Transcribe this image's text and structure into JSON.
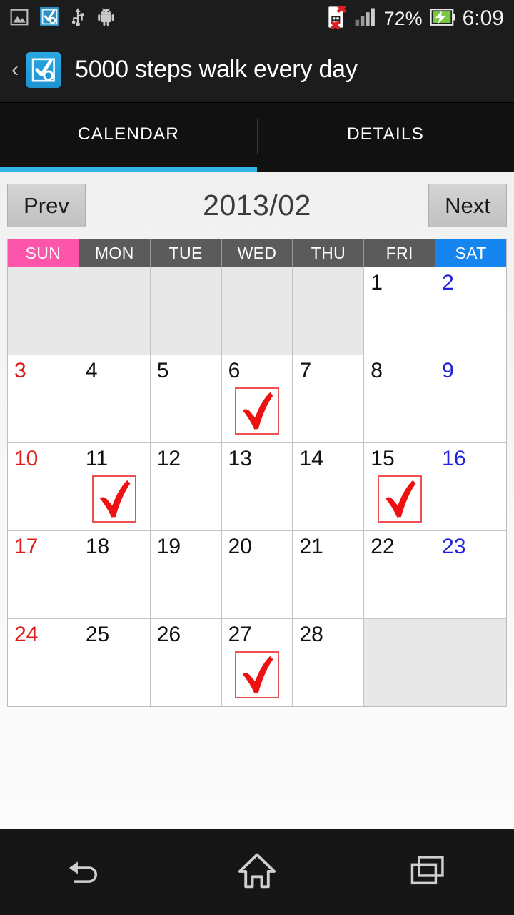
{
  "status_bar": {
    "notification_icons": [
      "image-icon",
      "app-checkmark-icon",
      "usb-icon",
      "android-icon"
    ],
    "sim_icon": "sim-card-error-icon",
    "signal_icon": "signal-bars-icon",
    "battery_percent": "72%",
    "battery_icon": "battery-charging-icon",
    "clock": "6:09"
  },
  "app_bar": {
    "back_label": "‹",
    "icon": "app-icon-checkmark",
    "title": "5000 steps walk every day"
  },
  "tabs": [
    {
      "label": "CALENDAR",
      "active": true
    },
    {
      "label": "DETAILS",
      "active": false
    }
  ],
  "month_nav": {
    "prev_label": "Prev",
    "next_label": "Next",
    "month_label": "2013/02"
  },
  "calendar": {
    "day_headers": [
      "SUN",
      "MON",
      "TUE",
      "WED",
      "THU",
      "FRI",
      "SAT"
    ],
    "colors": {
      "sunday_header": "#fc55a9",
      "saturday_header": "#1785ef",
      "weekday_header": "#5b5b5b",
      "sunday_text": "#e01b1b",
      "saturday_text": "#2222dd",
      "check_mark": "#ee1111",
      "check_border": "#ec5050",
      "tab_accent": "#33b5e5"
    },
    "weeks": [
      [
        {
          "day": "",
          "checked": false
        },
        {
          "day": "",
          "checked": false
        },
        {
          "day": "",
          "checked": false
        },
        {
          "day": "",
          "checked": false
        },
        {
          "day": "",
          "checked": false
        },
        {
          "day": "1",
          "checked": false
        },
        {
          "day": "2",
          "checked": false
        }
      ],
      [
        {
          "day": "3",
          "checked": false
        },
        {
          "day": "4",
          "checked": false
        },
        {
          "day": "5",
          "checked": false
        },
        {
          "day": "6",
          "checked": true
        },
        {
          "day": "7",
          "checked": false
        },
        {
          "day": "8",
          "checked": false
        },
        {
          "day": "9",
          "checked": false
        }
      ],
      [
        {
          "day": "10",
          "checked": false
        },
        {
          "day": "11",
          "checked": true
        },
        {
          "day": "12",
          "checked": false
        },
        {
          "day": "13",
          "checked": false
        },
        {
          "day": "14",
          "checked": false
        },
        {
          "day": "15",
          "checked": true
        },
        {
          "day": "16",
          "checked": false
        }
      ],
      [
        {
          "day": "17",
          "checked": false
        },
        {
          "day": "18",
          "checked": false
        },
        {
          "day": "19",
          "checked": false
        },
        {
          "day": "20",
          "checked": false
        },
        {
          "day": "21",
          "checked": false
        },
        {
          "day": "22",
          "checked": false
        },
        {
          "day": "23",
          "checked": false
        }
      ],
      [
        {
          "day": "24",
          "checked": false
        },
        {
          "day": "25",
          "checked": false
        },
        {
          "day": "26",
          "checked": false
        },
        {
          "day": "27",
          "checked": true
        },
        {
          "day": "28",
          "checked": false
        },
        {
          "day": "",
          "checked": false
        },
        {
          "day": "",
          "checked": false
        }
      ]
    ]
  },
  "nav_bar": {
    "buttons": [
      "back-icon",
      "home-icon",
      "recents-icon"
    ]
  }
}
